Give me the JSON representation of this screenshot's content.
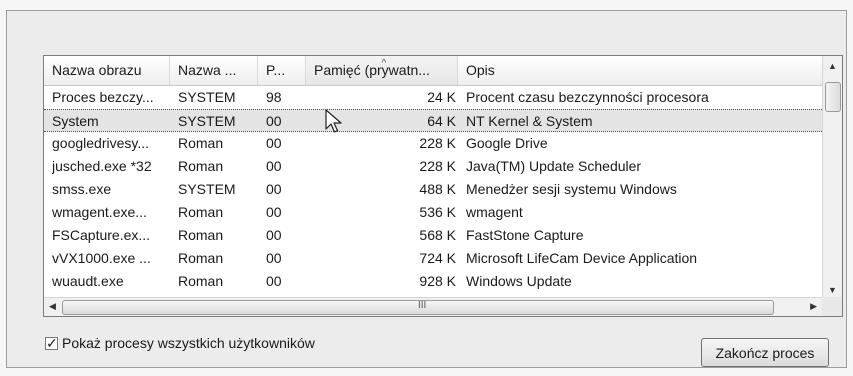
{
  "table": {
    "columns": [
      "Nazwa obrazu",
      "Nazwa ...",
      "P...",
      "Pamięć (prywatn...",
      "Opis"
    ],
    "sorted_column": "Pamięć (prywatn...",
    "rows": [
      [
        "Proces bezczy...",
        "SYSTEM",
        "98",
        "24 K",
        "Procent czasu bezczynności procesora"
      ],
      [
        "System",
        "SYSTEM",
        "00",
        "64 K",
        "NT Kernel & System"
      ],
      [
        "googledrivesy...",
        "Roman",
        "00",
        "228 K",
        "Google Drive"
      ],
      [
        "jusched.exe *32",
        "Roman",
        "00",
        "228 K",
        "Java(TM) Update Scheduler"
      ],
      [
        "smss.exe",
        "SYSTEM",
        "00",
        "488 K",
        "Menedżer sesji systemu Windows"
      ],
      [
        "wmagent.exe...",
        "Roman",
        "00",
        "536 K",
        "wmagent"
      ],
      [
        "FSCapture.ex...",
        "Roman",
        "00",
        "568 K",
        "FastStone Capture"
      ],
      [
        "vVX1000.exe ...",
        "Roman",
        "00",
        "724 K",
        "Microsoft LifeCam Device Application"
      ],
      [
        "wuaudt.exe",
        "Roman",
        "00",
        "928 K",
        "Windows Update"
      ]
    ],
    "selected_row": "System",
    "hscroll_grip": "III"
  },
  "footer": {
    "show_all_label": "Pokaż procesy wszystkich użytkowników",
    "show_all_checked": true,
    "end_process_label": "Zakończ proces"
  }
}
